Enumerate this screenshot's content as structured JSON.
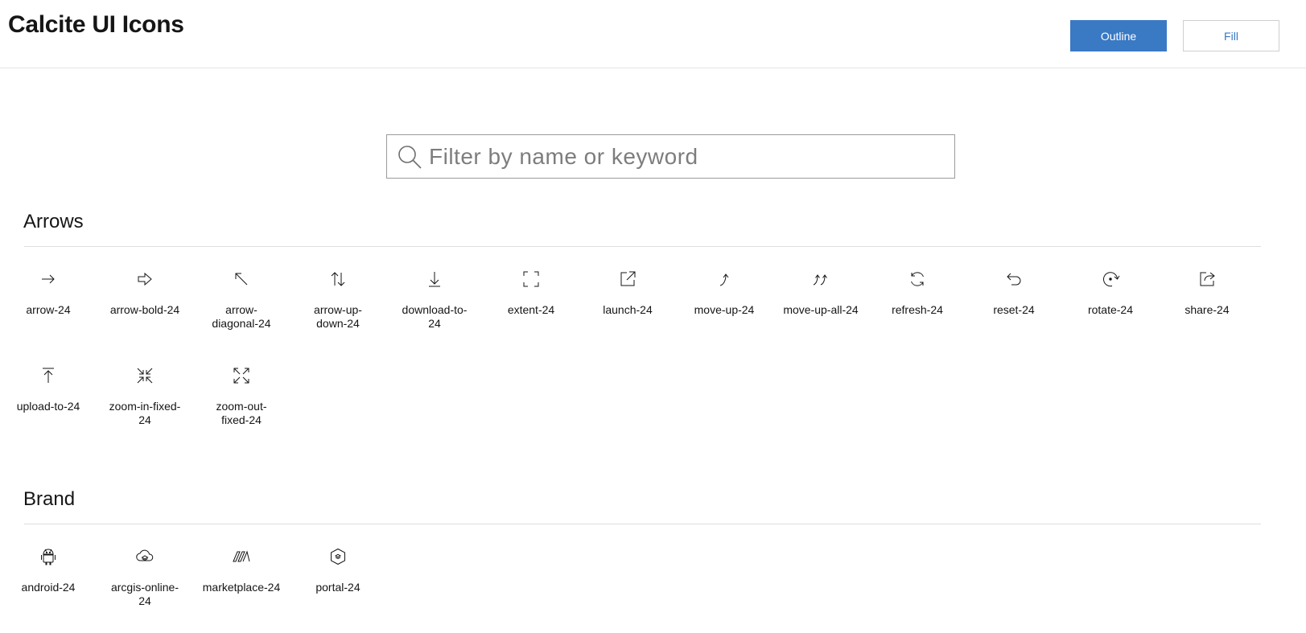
{
  "header": {
    "title": "Calcite UI Icons",
    "outline_label": "Outline",
    "fill_label": "Fill"
  },
  "search": {
    "placeholder": "Filter by name or keyword",
    "value": ""
  },
  "sections": [
    {
      "title": "Arrows",
      "icons": [
        {
          "label": "arrow-24",
          "icon": "arrow-icon"
        },
        {
          "label": "arrow-bold-24",
          "icon": "arrow-bold-icon"
        },
        {
          "label": "arrow-\ndiagonal-24",
          "icon": "arrow-diagonal-icon"
        },
        {
          "label": "arrow-up-\ndown-24",
          "icon": "arrow-up-down-icon"
        },
        {
          "label": "download-to-\n24",
          "icon": "download-to-icon"
        },
        {
          "label": "extent-24",
          "icon": "extent-icon"
        },
        {
          "label": "launch-24",
          "icon": "launch-icon"
        },
        {
          "label": "move-up-24",
          "icon": "move-up-icon"
        },
        {
          "label": "move-up-all-24",
          "icon": "move-up-all-icon"
        },
        {
          "label": "refresh-24",
          "icon": "refresh-icon"
        },
        {
          "label": "reset-24",
          "icon": "reset-icon"
        },
        {
          "label": "rotate-24",
          "icon": "rotate-icon"
        },
        {
          "label": "share-24",
          "icon": "share-icon"
        },
        {
          "label": "upload-to-24",
          "icon": "upload-to-icon"
        },
        {
          "label": "zoom-in-fixed-\n24",
          "icon": "zoom-in-fixed-icon"
        },
        {
          "label": "zoom-out-\nfixed-24",
          "icon": "zoom-out-fixed-icon"
        }
      ]
    },
    {
      "title": "Brand",
      "icons": [
        {
          "label": "android-24",
          "icon": "android-icon"
        },
        {
          "label": "arcgis-online-\n24",
          "icon": "arcgis-online-icon"
        },
        {
          "label": "marketplace-24",
          "icon": "marketplace-icon"
        },
        {
          "label": "portal-24",
          "icon": "portal-icon"
        }
      ]
    }
  ],
  "colors": {
    "accent": "#3a79c4",
    "text": "#151515",
    "divider": "#dedede"
  }
}
